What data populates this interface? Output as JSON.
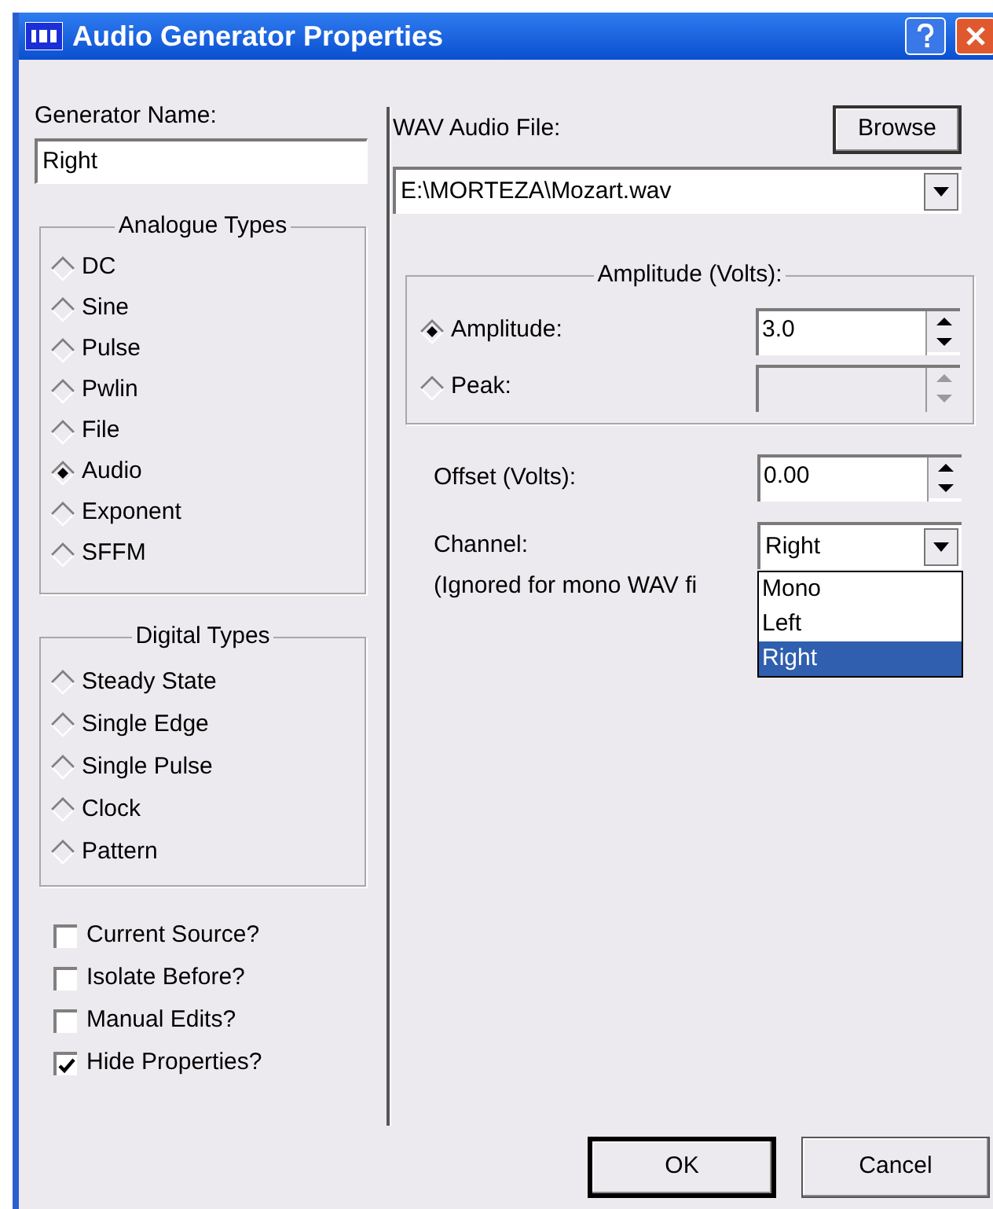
{
  "window": {
    "title": "Audio Generator Properties"
  },
  "generator_name": {
    "label": "Generator Name:",
    "value": "Right"
  },
  "analogue_types": {
    "title": "Analogue Types",
    "options": [
      {
        "label": "DC",
        "selected": false
      },
      {
        "label": "Sine",
        "selected": false
      },
      {
        "label": "Pulse",
        "selected": false
      },
      {
        "label": "Pwlin",
        "selected": false
      },
      {
        "label": "File",
        "selected": false
      },
      {
        "label": "Audio",
        "selected": true
      },
      {
        "label": "Exponent",
        "selected": false
      },
      {
        "label": "SFFM",
        "selected": false
      }
    ]
  },
  "digital_types": {
    "title": "Digital Types",
    "options": [
      {
        "label": "Steady State",
        "selected": false
      },
      {
        "label": "Single Edge",
        "selected": false
      },
      {
        "label": "Single Pulse",
        "selected": false
      },
      {
        "label": "Clock",
        "selected": false
      },
      {
        "label": "Pattern",
        "selected": false
      }
    ]
  },
  "checkboxes": [
    {
      "label": "Current Source?",
      "checked": false
    },
    {
      "label": "Isolate Before?",
      "checked": false
    },
    {
      "label": "Manual Edits?",
      "checked": false
    },
    {
      "label": "Hide Properties?",
      "checked": true
    }
  ],
  "wav_file": {
    "label": "WAV Audio File:",
    "browse": "Browse",
    "value": "E:\\MORTEZA\\Mozart.wav"
  },
  "amplitude": {
    "title": "Amplitude (Volts):",
    "options": [
      {
        "label": "Amplitude:",
        "selected": true,
        "disabled": false,
        "value": "3.0"
      },
      {
        "label": "Peak:",
        "selected": false,
        "disabled": true
      }
    ]
  },
  "offset": {
    "label": "Offset (Volts):",
    "value": "0.00"
  },
  "channel": {
    "label": "Channel:",
    "value": "Right",
    "note": "(Ignored for mono WAV fi",
    "expanded": true,
    "options": [
      {
        "label": "Mono",
        "selected": false
      },
      {
        "label": "Left",
        "selected": false
      },
      {
        "label": "Right",
        "selected": true
      }
    ]
  },
  "buttons": [
    {
      "label": "OK",
      "default": true
    },
    {
      "label": "Cancel",
      "default": false
    }
  ]
}
